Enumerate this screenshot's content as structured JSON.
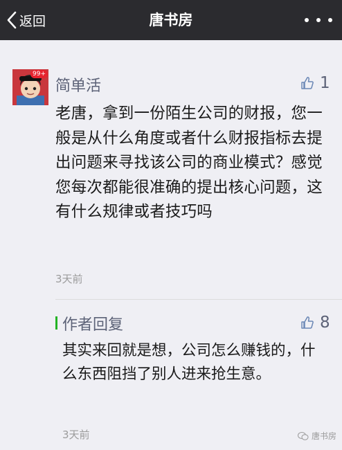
{
  "header": {
    "back_label": "返回",
    "title": "唐书房",
    "more_icon": "more-dots-icon"
  },
  "comment": {
    "username": "简单活",
    "avatar_badge": "99+",
    "likes": "1",
    "text": "老唐，拿到一份陌生公司的财报，您一般是从什么角度或者什么财报指标去提出问题来寻找该公司的商业模式？感觉您每次都能很准确的提出核心问题，这有什么规律或者技巧吗",
    "time": "3天前"
  },
  "reply": {
    "label": "作者回复",
    "likes": "8",
    "text": "其实来回就是想，公司怎么赚钱的，什么东西阻挡了别人进来抢生意。",
    "time": "3天前"
  },
  "watermark": {
    "text": "唐书房",
    "icon": "wechat-icon"
  },
  "colors": {
    "topbar": "#2b2b2f",
    "background": "#efeff4",
    "name_blue": "#5c6277",
    "reply_accent": "#23b324"
  }
}
